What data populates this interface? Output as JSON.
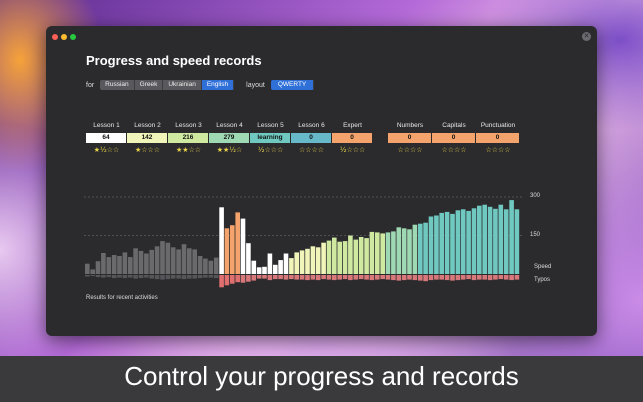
{
  "window": {
    "title": "Progress and speed records"
  },
  "filters": {
    "for_label": "for",
    "languages": [
      "Russian",
      "Greek",
      "Ukrainian",
      "English"
    ],
    "selected_language": "English",
    "layout_label": "layout",
    "layouts": [
      "QWERTY"
    ],
    "selected_layout": "QWERTY"
  },
  "lessons": [
    {
      "name": "Lesson 1",
      "value": "64",
      "color": "#ffffff",
      "stars": "★½☆☆"
    },
    {
      "name": "Lesson 2",
      "value": "142",
      "color": "#f1f5b9",
      "stars": "★☆☆☆"
    },
    {
      "name": "Lesson 3",
      "value": "216",
      "color": "#cfe9a1",
      "stars": "★★☆☆"
    },
    {
      "name": "Lesson 4",
      "value": "279",
      "color": "#9fd9b3",
      "stars": "★★½☆"
    },
    {
      "name": "Lesson 5",
      "value": "learning",
      "color": "#6fc9c1",
      "stars": "½☆☆☆"
    },
    {
      "name": "Lesson 6",
      "value": "0",
      "color": "#67b8c9",
      "stars": "☆☆☆☆"
    },
    {
      "name": "Expert",
      "value": "0",
      "color": "#f4a36c",
      "stars": "½☆☆☆"
    }
  ],
  "extras": [
    {
      "name": "Numbers",
      "value": "0",
      "color": "#f4a36c",
      "stars": "☆☆☆☆"
    },
    {
      "name": "Capitals",
      "value": "0",
      "color": "#f4a36c",
      "stars": "☆☆☆☆"
    },
    {
      "name": "Punctuation",
      "value": "0",
      "color": "#f4a36c",
      "stars": "☆☆☆☆"
    }
  ],
  "chart_data": {
    "type": "bar",
    "ytick_labels": [
      "300",
      "150"
    ],
    "series": [
      {
        "name": "Speed",
        "values": [
          40,
          18,
          50,
          82,
          66,
          74,
          70,
          84,
          66,
          100,
          90,
          80,
          94,
          108,
          128,
          122,
          104,
          96,
          116,
          100,
          96,
          70,
          60,
          52,
          64,
          260,
          178,
          190,
          240,
          216,
          120,
          52,
          26,
          28,
          80,
          36,
          54,
          80,
          62,
          84,
          92,
          98,
          108,
          104,
          122,
          130,
          142,
          126,
          128,
          150,
          134,
          144,
          140,
          164,
          162,
          158,
          162,
          166,
          182,
          178,
          174,
          192,
          196,
          200,
          224,
          228,
          238,
          242,
          234,
          248,
          252,
          246,
          256,
          266,
          270,
          262,
          254,
          270,
          252,
          288,
          252
        ]
      },
      {
        "name": "Typos",
        "values": [
          6,
          4,
          8,
          10,
          8,
          12,
          10,
          12,
          10,
          14,
          12,
          10,
          14,
          16,
          18,
          16,
          14,
          14,
          16,
          14,
          14,
          12,
          10,
          10,
          12,
          48,
          40,
          34,
          28,
          30,
          26,
          22,
          14,
          14,
          20,
          16,
          16,
          18,
          16,
          18,
          18,
          20,
          18,
          20,
          16,
          18,
          20,
          18,
          16,
          20,
          18,
          16,
          18,
          20,
          18,
          16,
          18,
          20,
          22,
          20,
          18,
          20,
          22,
          24,
          20,
          18,
          18,
          20,
          22,
          20,
          18,
          16,
          20,
          18,
          18,
          20,
          18,
          16,
          18,
          20,
          18
        ]
      }
    ],
    "legend": [
      "Speed",
      "Typos"
    ],
    "ylim": [
      0,
      300
    ]
  },
  "footer": "Results for recent activities",
  "caption": "Control your progress and records"
}
